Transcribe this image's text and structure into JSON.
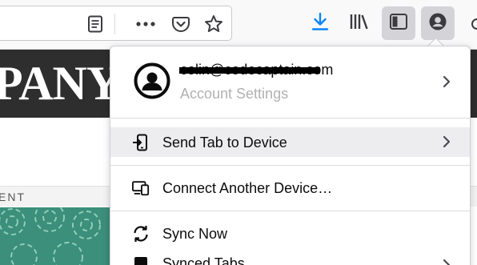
{
  "toolbar": {
    "icons": [
      "reader-view-icon",
      "page-actions-icon",
      "pocket-icon",
      "bookmark-star-icon",
      "downloads-icon",
      "library-icon",
      "sidebars-icon",
      "account-icon"
    ],
    "accent_color": "#0a84ff"
  },
  "page": {
    "banner_text": "PANY",
    "nav_text": "ENT"
  },
  "panel": {
    "account": {
      "email": "colin@codecaptain.com",
      "subtitle": "Account Settings"
    },
    "items": [
      {
        "label": "Send Tab to Device",
        "icon": "send-tab-icon",
        "has_submenu": true,
        "highlighted": true
      },
      {
        "label": "Connect Another Device…",
        "icon": "connect-device-icon",
        "has_submenu": false,
        "highlighted": false
      },
      {
        "label": "Sync Now",
        "icon": "sync-icon",
        "has_submenu": false,
        "highlighted": false
      },
      {
        "label": "Synced Tabs",
        "icon": "synced-tabs-icon",
        "has_submenu": true,
        "highlighted": false
      }
    ]
  }
}
